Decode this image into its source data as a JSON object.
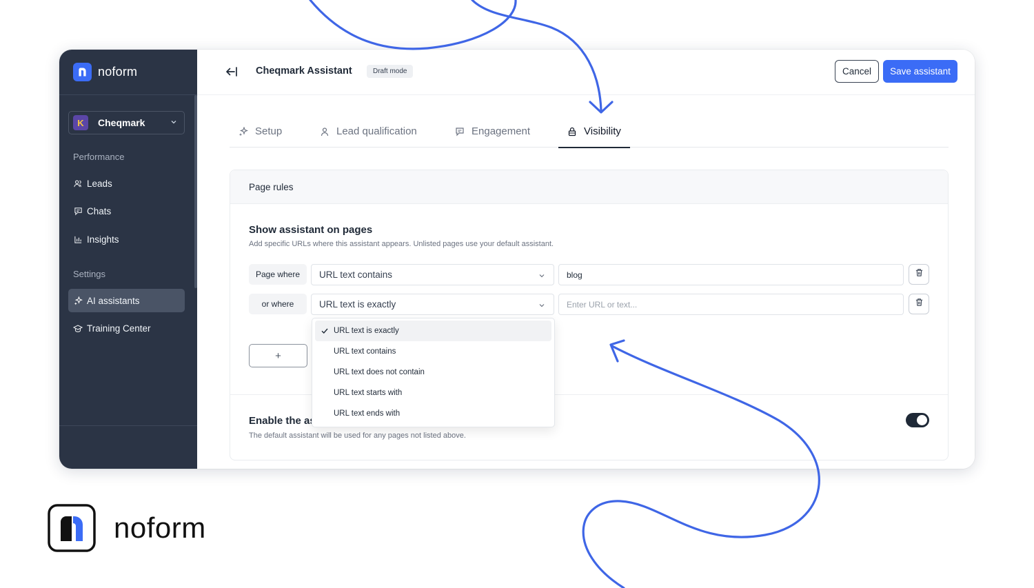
{
  "brand": {
    "name": "noform",
    "accent": "#3b6cf6",
    "sidebar_bg": "#2b3445"
  },
  "sidebar": {
    "workspace": {
      "initial": "K",
      "name": "Cheqmark"
    },
    "sections": {
      "performance": "Performance",
      "settings": "Settings"
    },
    "items": [
      {
        "label": "Leads",
        "icon": "users-icon"
      },
      {
        "label": "Chats",
        "icon": "chat-icon"
      },
      {
        "label": "Insights",
        "icon": "bar-chart-icon"
      },
      {
        "label": "AI assistants",
        "icon": "sparkle-icon",
        "active": true
      },
      {
        "label": "Training Center",
        "icon": "graduation-cap-icon"
      }
    ]
  },
  "header": {
    "title": "Cheqmark Assistant",
    "badge": "Draft mode",
    "cancel_label": "Cancel",
    "save_label": "Save assistant"
  },
  "tabs": [
    {
      "label": "Setup",
      "icon": "sparkle-icon"
    },
    {
      "label": "Lead qualification",
      "icon": "user-icon"
    },
    {
      "label": "Engagement",
      "icon": "message-icon"
    },
    {
      "label": "Visibility",
      "icon": "lock-icon",
      "active": true
    }
  ],
  "page_rules": {
    "card_title": "Page rules",
    "section_title": "Show assistant on pages",
    "section_subtitle": "Add specific URLs where this assistant appears. Unlisted pages use your default assistant.",
    "rules": [
      {
        "prefix": "Page where",
        "condition": "URL text contains",
        "value": "blog",
        "placeholder": ""
      },
      {
        "prefix": "or where",
        "condition": "URL text is exactly",
        "value": "",
        "placeholder": "Enter URL or text..."
      }
    ],
    "add_label": "+",
    "dropdown_options": [
      {
        "label": "URL text is exactly",
        "selected": true
      },
      {
        "label": "URL text contains"
      },
      {
        "label": "URL text does not contain"
      },
      {
        "label": "URL text starts with"
      },
      {
        "label": "URL text ends with"
      }
    ]
  },
  "default_section": {
    "title": "Enable the as",
    "subtitle": "The default assistant will be used for any pages not listed above.",
    "toggle_on": true
  },
  "footer_brand": {
    "name": "noform"
  }
}
